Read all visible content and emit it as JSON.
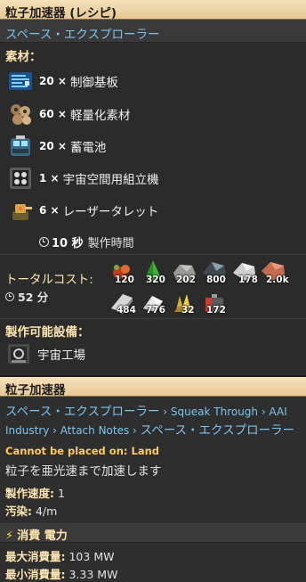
{
  "recipe_panel": {
    "title": "粒子加速器 (レシピ)",
    "source": "スペース・エクスプローラー",
    "ingredients_label": "素材：",
    "ingredients": [
      {
        "count": "20 ×",
        "name": "制御基板",
        "icon": "circuit-board-icon"
      },
      {
        "count": "60 ×",
        "name": "軽量化素材",
        "icon": "lightweight-material-icon"
      },
      {
        "count": "20 ×",
        "name": "蓄電池",
        "icon": "accumulator-icon"
      },
      {
        "count": "1 ×",
        "name": "宇宙空間用組立機",
        "icon": "space-assembler-icon"
      },
      {
        "count": "6 ×",
        "name": "レーザータレット",
        "icon": "laser-turret-icon"
      }
    ],
    "craft_time_value": "10 秒",
    "craft_time_label": "製作時間",
    "total_cost_label": "トータルコスト:",
    "total_cost_time": "52 分",
    "total_cost_items": [
      {
        "value": "120",
        "icon": "ore-cluster-icon"
      },
      {
        "value": "320",
        "icon": "green-crystal-icon"
      },
      {
        "value": "202",
        "icon": "stone-icon"
      },
      {
        "value": "800",
        "icon": "dark-ore-icon"
      },
      {
        "value": "178",
        "icon": "grey-ore-icon"
      },
      {
        "value": "2.0k",
        "icon": "copper-ore-icon"
      },
      {
        "value": "484",
        "icon": "plate-icon"
      },
      {
        "value": "776",
        "icon": "white-crystal-icon"
      },
      {
        "value": "32",
        "icon": "gold-crystal-icon"
      },
      {
        "value": "172",
        "icon": "battery-icon"
      }
    ],
    "made_in_label": "製作可能設備：",
    "made_in": {
      "name": "宇宙工場",
      "icon": "space-factory-icon"
    }
  },
  "entity_panel": {
    "title": "粒子加速器",
    "mods_line1": [
      {
        "text": "スペース・エクスプローラー",
        "big": true
      },
      {
        "text": " › Squeak Through › AAI",
        "big": false
      }
    ],
    "mods_line2": [
      {
        "text": "Industry › Attach Notes › ",
        "big": false
      },
      {
        "text": "スペース・エクスプローラー",
        "big": true
      }
    ],
    "placement_warning": "Cannot be placed on: Land",
    "description": "粒子を亜光速まで加速します",
    "crafting_speed_label": "製作速度:",
    "crafting_speed_value": "1",
    "pollution_label": "汚染:",
    "pollution_value": "4/m",
    "energy_header": "消費 電力",
    "max_consumption_label": "最大消費量:",
    "max_consumption_value": "103 MW",
    "min_consumption_label": "最小消費量:",
    "min_consumption_value": "3.33 MW"
  },
  "colors": {
    "header_bg": "#f0d9b0",
    "section_label": "#ffe6b0",
    "link_blue": "#7cc3ec",
    "warning": "#ffd24c"
  }
}
